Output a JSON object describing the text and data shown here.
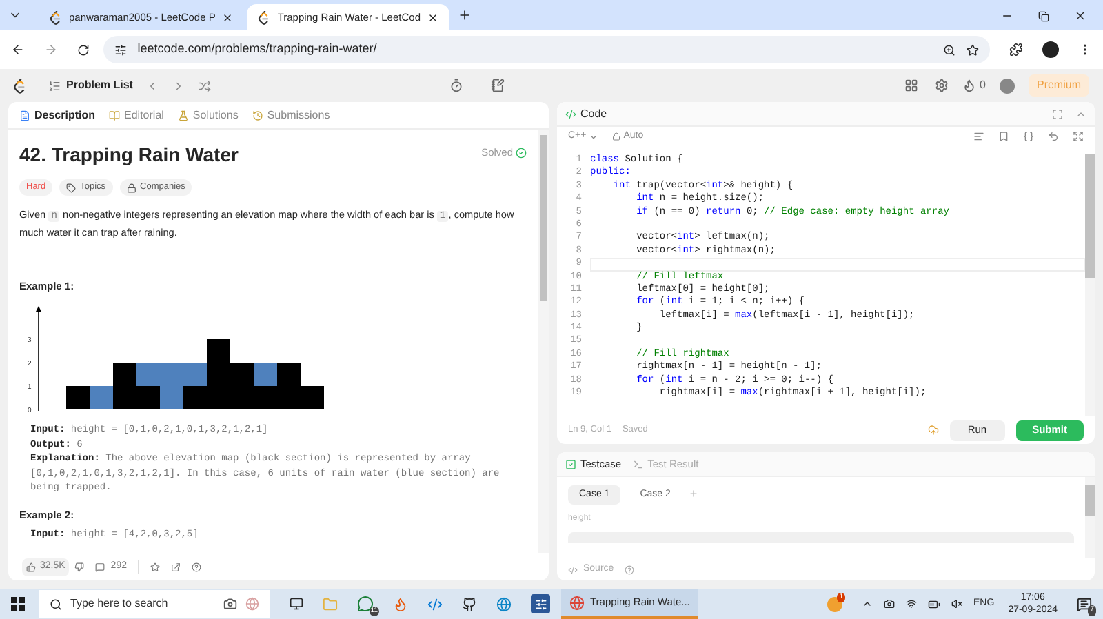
{
  "browser": {
    "tabs": [
      {
        "title": "panwaraman2005 - LeetCode P",
        "selected": false
      },
      {
        "title": "Trapping Rain Water - LeetCod",
        "selected": true
      }
    ],
    "url": "leetcode.com/problems/trapping-rain-water/"
  },
  "topbar": {
    "problem_list": "Problem List",
    "streak": "0",
    "premium": "Premium"
  },
  "left": {
    "tabs": [
      {
        "label": "Description",
        "selected": true
      },
      {
        "label": "Editorial",
        "selected": false
      },
      {
        "label": "Solutions",
        "selected": false
      },
      {
        "label": "Submissions",
        "selected": false
      }
    ],
    "title": "42. Trapping Rain Water",
    "status": "Solved",
    "tags": [
      {
        "label": "Hard",
        "kind": "difficulty"
      },
      {
        "label": "Topics",
        "kind": "topics"
      },
      {
        "label": "Companies",
        "kind": "companies"
      }
    ],
    "description": [
      {
        "text": "Given ",
        "kind": "plain"
      },
      {
        "text": "n",
        "kind": "code"
      },
      {
        "text": " non-negative integers representing an elevation map where the width of each bar is ",
        "kind": "plain"
      },
      {
        "text": "1",
        "kind": "code"
      },
      {
        "text": ", compute how much water it can trap after raining.",
        "kind": "plain"
      }
    ],
    "examples": [
      {
        "title": "Example 1:",
        "figure_y_labels": [
          "3",
          "2",
          "1",
          "0"
        ],
        "lines": [
          {
            "label": "Input:",
            "text": "height = [0,1,0,2,1,0,1,3,2,1,2,1]"
          },
          {
            "label": "Output:",
            "text": "6"
          },
          {
            "label": "Explanation:",
            "text": "The above elevation map (black section) is represented by array [0,1,0,2,1,0,1,3,2,1,2,1]. In this case, 6 units of rain water (blue section) are being trapped."
          }
        ]
      },
      {
        "title": "Example 2:",
        "lines": [
          {
            "label": "Input:",
            "text": "height = [4,2,0,3,2,5]"
          }
        ]
      }
    ],
    "likes": "32.5K",
    "comments": "292"
  },
  "editor": {
    "title": "Code",
    "language": "C++",
    "mode": "Auto",
    "lines": [
      {
        "n": "1",
        "current": false,
        "segs": [
          {
            "kind": "keyword",
            "text": "class"
          },
          {
            "kind": "plain",
            "text": " Solution {"
          }
        ]
      },
      {
        "n": "2",
        "current": false,
        "segs": [
          {
            "kind": "keyword",
            "text": "public:"
          }
        ]
      },
      {
        "n": "3",
        "current": false,
        "segs": [
          {
            "kind": "keyword",
            "text": "    int"
          },
          {
            "kind": "plain",
            "text": " trap(vector<"
          },
          {
            "kind": "keyword",
            "text": "int"
          },
          {
            "kind": "plain",
            "text": ">& height) {"
          }
        ]
      },
      {
        "n": "4",
        "current": false,
        "segs": [
          {
            "kind": "keyword",
            "text": "        int"
          },
          {
            "kind": "plain",
            "text": " n = height.size();"
          }
        ]
      },
      {
        "n": "5",
        "current": false,
        "segs": [
          {
            "kind": "keyword",
            "text": "        if"
          },
          {
            "kind": "plain",
            "text": " (n == 0) "
          },
          {
            "kind": "keyword",
            "text": "return"
          },
          {
            "kind": "plain",
            "text": " 0; "
          },
          {
            "kind": "comment",
            "text": "// Edge case: empty height array"
          }
        ]
      },
      {
        "n": "6",
        "current": false
      },
      {
        "n": "7",
        "current": false,
        "segs": [
          {
            "kind": "plain",
            "text": "        vector<"
          },
          {
            "kind": "keyword",
            "text": "int"
          },
          {
            "kind": "plain",
            "text": "> leftmax(n);"
          }
        ]
      },
      {
        "n": "8",
        "current": false,
        "segs": [
          {
            "kind": "plain",
            "text": "        vector<"
          },
          {
            "kind": "keyword",
            "text": "int"
          },
          {
            "kind": "plain",
            "text": "> rightmax(n);"
          }
        ]
      },
      {
        "n": "9",
        "current": true
      },
      {
        "n": "10",
        "current": false,
        "segs": [
          {
            "kind": "comment",
            "text": "        // Fill leftmax"
          }
        ]
      },
      {
        "n": "11",
        "current": false,
        "segs": [
          {
            "kind": "plain",
            "text": "        leftmax[0] = height[0];"
          }
        ]
      },
      {
        "n": "12",
        "current": false,
        "segs": [
          {
            "kind": "keyword",
            "text": "        for"
          },
          {
            "kind": "plain",
            "text": " ("
          },
          {
            "kind": "keyword",
            "text": "int"
          },
          {
            "kind": "plain",
            "text": " i = 1; i < n; i++) {"
          }
        ]
      },
      {
        "n": "13",
        "current": false,
        "segs": [
          {
            "kind": "plain",
            "text": "            leftmax[i] = "
          },
          {
            "kind": "keyword",
            "text": "max"
          },
          {
            "kind": "plain",
            "text": "(leftmax[i - 1], height[i]);"
          }
        ]
      },
      {
        "n": "14",
        "current": false,
        "segs": [
          {
            "kind": "plain",
            "text": "        }"
          }
        ]
      },
      {
        "n": "15",
        "current": false
      },
      {
        "n": "16",
        "current": false,
        "segs": [
          {
            "kind": "comment",
            "text": "        // Fill rightmax"
          }
        ]
      },
      {
        "n": "17",
        "current": false,
        "segs": [
          {
            "kind": "plain",
            "text": "        rightmax[n - 1] = height[n - 1];"
          }
        ]
      },
      {
        "n": "18",
        "current": false,
        "segs": [
          {
            "kind": "keyword",
            "text": "        for"
          },
          {
            "kind": "plain",
            "text": " ("
          },
          {
            "kind": "keyword",
            "text": "int"
          },
          {
            "kind": "plain",
            "text": " i = n - 2; i >= 0; i--) {"
          }
        ]
      },
      {
        "n": "19",
        "current": false,
        "segs": [
          {
            "kind": "plain",
            "text": "            rightmax[i] = "
          },
          {
            "kind": "keyword",
            "text": "max"
          },
          {
            "kind": "plain",
            "text": "(rightmax[i + 1], height[i]);"
          }
        ]
      }
    ],
    "position": "Ln 9, Col 1",
    "saved": "Saved",
    "run": "Run",
    "submit": "Submit"
  },
  "testcase": {
    "tabs": [
      {
        "label": "Testcase",
        "selected": true
      },
      {
        "label": "Test Result",
        "selected": false
      }
    ],
    "cases": [
      {
        "label": "Case 1",
        "selected": true
      },
      {
        "label": "Case 2",
        "selected": false
      }
    ],
    "add": "+",
    "param": "height =",
    "source": "Source"
  },
  "taskbar": {
    "search": "Type here to search",
    "whatsapp_badge": "11",
    "app": "Trapping Rain Wate...",
    "tray_badge": "1",
    "language": "ENG",
    "time": "17:06",
    "date": "27-09-2024",
    "notifications": "7"
  }
}
